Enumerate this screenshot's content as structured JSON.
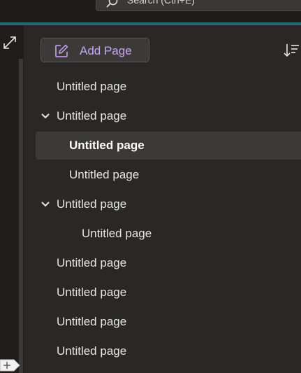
{
  "search": {
    "placeholder": "Search (Ctrl+E)"
  },
  "toolbar": {
    "add_page_label": "Add Page"
  },
  "colors": {
    "accent": "#c8a6f3",
    "teal_bar": "#1f6c73",
    "panel_bg": "#292827",
    "selected_bg": "#3b3a39"
  },
  "icons": {
    "search": "search-icon",
    "expand": "expand-icon",
    "add_page": "edit-page-icon",
    "sort": "sort-icon",
    "chevron": "chevron-down-icon",
    "add_tab": "plus-icon"
  },
  "pages": [
    {
      "label": "Untitled page",
      "level": 0,
      "expanded": null,
      "selected": false
    },
    {
      "label": "Untitled page",
      "level": 0,
      "expanded": true,
      "selected": false
    },
    {
      "label": "Untitled page",
      "level": 1,
      "expanded": null,
      "selected": true
    },
    {
      "label": "Untitled page",
      "level": 1,
      "expanded": null,
      "selected": false
    },
    {
      "label": "Untitled page",
      "level": 0,
      "expanded": true,
      "selected": false
    },
    {
      "label": "Untitled page",
      "level": 2,
      "expanded": null,
      "selected": false
    },
    {
      "label": "Untitled page",
      "level": 0,
      "expanded": null,
      "selected": false
    },
    {
      "label": "Untitled page",
      "level": 0,
      "expanded": null,
      "selected": false
    },
    {
      "label": "Untitled page",
      "level": 0,
      "expanded": null,
      "selected": false
    },
    {
      "label": "Untitled page",
      "level": 0,
      "expanded": null,
      "selected": false
    }
  ]
}
